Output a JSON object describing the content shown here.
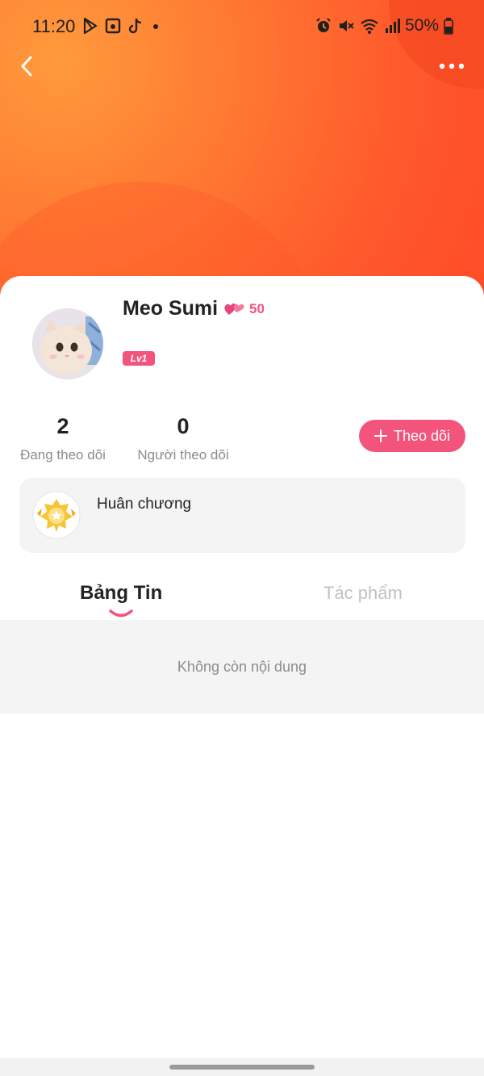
{
  "status_bar": {
    "time": "11:20",
    "battery": "50%",
    "left_icons": [
      "play-store-icon",
      "media-icon",
      "tiktok-icon",
      "dot-icon"
    ],
    "right_icons": [
      "alarm-icon",
      "mute-icon",
      "wifi-icon",
      "signal-icon",
      "battery-icon"
    ]
  },
  "nav": {
    "back_icon": "chevron-left-icon",
    "more_icon": "more-dots-icon"
  },
  "profile": {
    "name": "Meo Sumi",
    "hearts_count": "50",
    "level": "Lv1"
  },
  "stats": {
    "following_count": "2",
    "following_label": "Đang theo dõi",
    "followers_count": "0",
    "followers_label": "Người theo dõi"
  },
  "follow_button": {
    "icon": "plus-icon",
    "label": "Theo dõi"
  },
  "medal": {
    "label": "Huân chương"
  },
  "tabs": [
    {
      "label": "Bảng Tin",
      "active": true
    },
    {
      "label": "Tác phẩm",
      "active": false
    }
  ],
  "content": {
    "empty_message": "Không còn nội dung"
  },
  "colors": {
    "accent": "#f2547c",
    "header_orange": "#ff5a2c"
  }
}
